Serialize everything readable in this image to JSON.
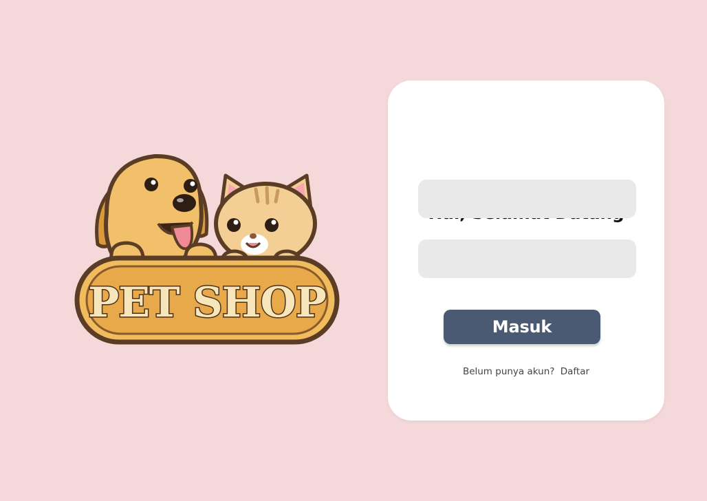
{
  "colors": {
    "background": "#f5d9da",
    "card": "#ffffff",
    "input": "#e9e9e9",
    "button": "#4a5a73",
    "button_text": "#ffffff",
    "logo_dog": "#f2c06b",
    "logo_cat": "#f4cf95",
    "logo_outline": "#5a3d24",
    "logo_banner": "#f1bc5e",
    "logo_tongue": "#f08a96"
  },
  "logo": {
    "text": "PET SHOP"
  },
  "login": {
    "title": "Hai, Selamat Datang",
    "username": {
      "value": "",
      "placeholder": ""
    },
    "password": {
      "value": "",
      "placeholder": ""
    },
    "submit_label": "Masuk",
    "signup_prompt": "Belum punya akun?",
    "signup_link": "Daftar"
  }
}
